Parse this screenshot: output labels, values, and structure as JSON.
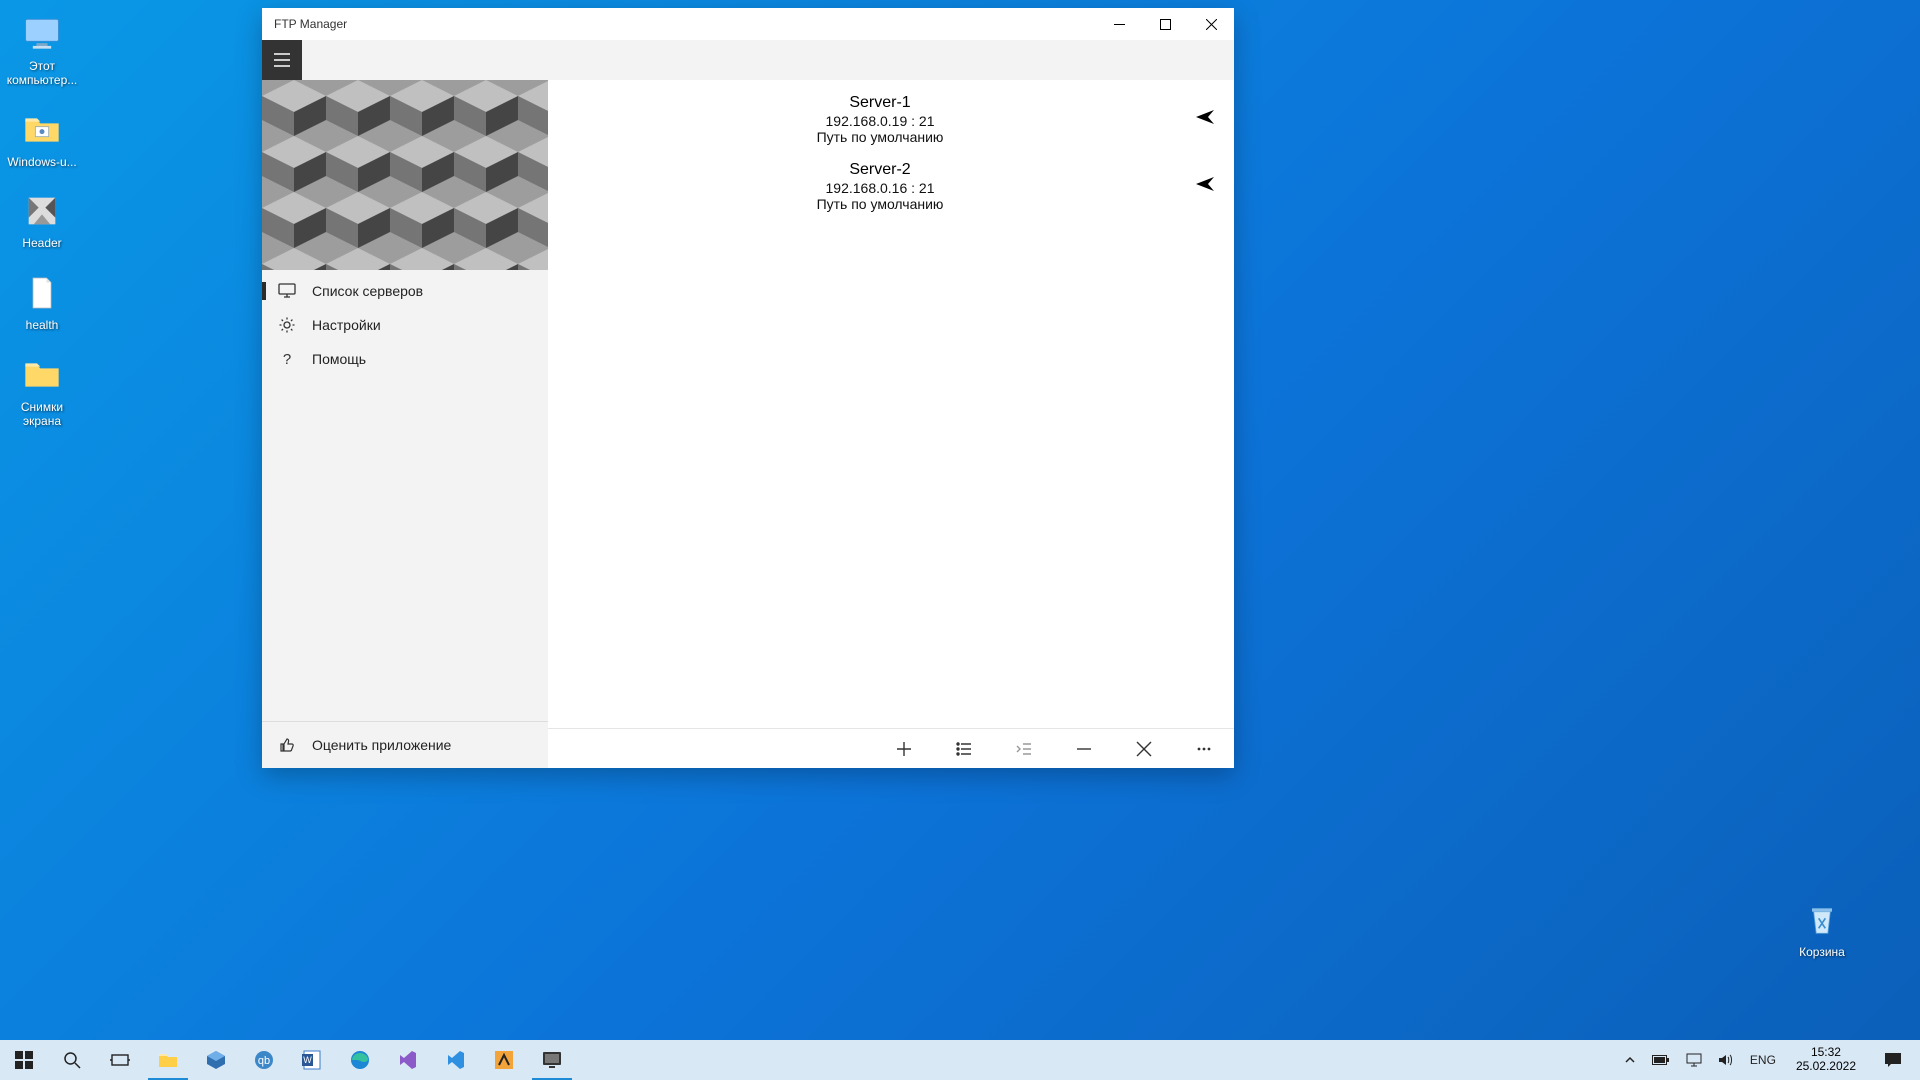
{
  "desktop": {
    "icons": [
      {
        "name": "this-pc",
        "label": "Этот\nкомпьютер..."
      },
      {
        "name": "windows-u",
        "label": "Windows-u..."
      },
      {
        "name": "header",
        "label": "Header"
      },
      {
        "name": "health",
        "label": "health"
      },
      {
        "name": "screenshots",
        "label": "Снимки\nэкрана"
      }
    ],
    "recycle_bin": "Корзина"
  },
  "app": {
    "title": "FTP Manager",
    "nav": {
      "servers": "Список серверов",
      "settings": "Настройки",
      "help": "Помощь",
      "rate": "Оценить приложение"
    },
    "servers": [
      {
        "name": "Server-1",
        "host": "192.168.0.19 : 21",
        "path": "Путь по умолчанию"
      },
      {
        "name": "Server-2",
        "host": "192.168.0.16 : 21",
        "path": "Путь по умолчанию"
      }
    ]
  },
  "taskbar": {
    "lang": "ENG",
    "time": "15:32",
    "date": "25.02.2022"
  }
}
